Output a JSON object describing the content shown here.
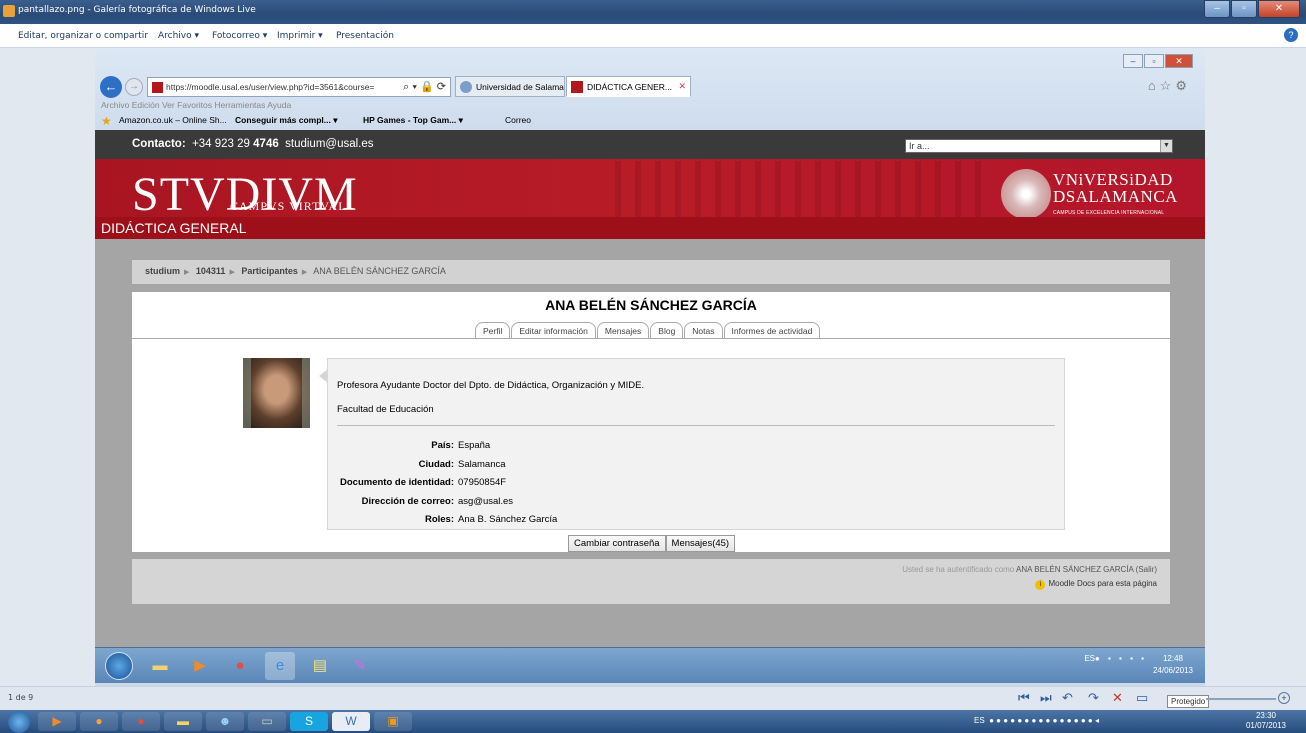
{
  "viewer": {
    "title": "pantallazo.png - Galería fotográfica de Windows Live",
    "menu": [
      "Editar, organizar o compartir",
      "Archivo ▾",
      "Fotocorreo ▾",
      "Imprimir ▾",
      "Presentación"
    ],
    "count": "1 de 9",
    "protected_label": "Protegido"
  },
  "browser": {
    "address": "https://moodle.usal.es/user/view.php?id=3561&course=",
    "tabs": [
      "Universidad de Salama...",
      "DIDÁCTICA GENER..."
    ],
    "menu": "Archivo  Edición  Ver  Favoritos  Herramientas  Ayuda",
    "favorites": [
      "Amazon.co.uk – Online Sh...",
      "Conseguir más compl... ▾",
      "HP Games - Top Gam... ▾",
      "Correo"
    ]
  },
  "site": {
    "contact_label": "Contacto:",
    "phone_prefix": "+34 923 29",
    "phone_bold": "4746",
    "email": "studium@usal.es",
    "goto_placeholder": "Ir a...",
    "logo": "STVDIVM",
    "logo_sub": "CAMPVS VIRTVAL",
    "university_line1": "VNiVERSiDAD",
    "university_line2": "DSALAMANCA",
    "university_sub": "CAMPUS DE EXCELENCIA INTERNACIONAL",
    "course": "DIDÁCTICA GENERAL"
  },
  "breadcrumb": [
    "studium",
    "104311",
    "Participantes",
    "ANA BELÉN SÁNCHEZ GARCÍA"
  ],
  "profile": {
    "name": "ANA BELÉN SÁNCHEZ GARCÍA",
    "tabs": [
      "Perfil",
      "Editar información",
      "Mensajes",
      "Blog",
      "Notas",
      "Informes de actividad"
    ],
    "description": "Profesora Ayudante Doctor del Dpto. de Didáctica, Organización y MIDE.",
    "faculty": "Facultad de Educación",
    "fields": [
      {
        "label": "País:",
        "value": "España"
      },
      {
        "label": "Ciudad:",
        "value": "Salamanca"
      },
      {
        "label": "Documento de identidad:",
        "value": "07950854F"
      },
      {
        "label": "Dirección de correo:",
        "value": "asg@usal.es"
      },
      {
        "label": "Roles:",
        "value": "Ana B. Sánchez García"
      }
    ],
    "buttons": [
      "Cambiar contraseña",
      "Mensajes(45)"
    ]
  },
  "footer": {
    "login_prefix": "Usted se ha autentificado como",
    "login_user": "ANA BELÉN SÁNCHEZ GARCÍA",
    "login_suffix": "(Salir)",
    "docs": "Moodle Docs para esta página"
  },
  "inner_taskbar": {
    "lang": "ES",
    "time": "12:48",
    "date": "24/06/2013"
  },
  "outer_taskbar": {
    "lang": "ES",
    "time": "23:30",
    "date": "01/07/2013"
  },
  "colors": {
    "brand_red": "#b81c27",
    "dark_bar": "#3a3a3a"
  }
}
